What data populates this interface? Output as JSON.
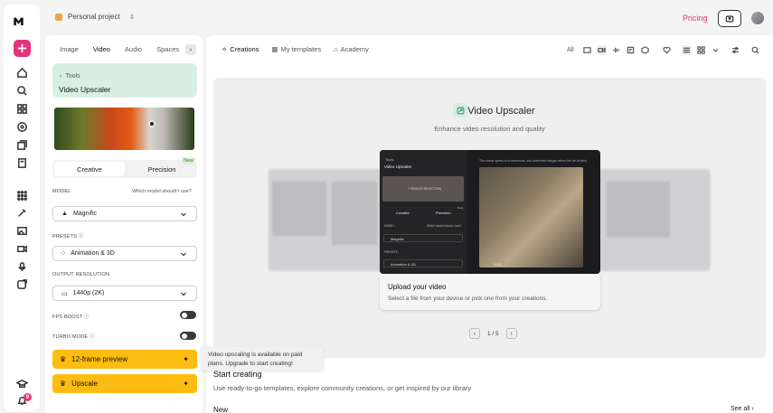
{
  "app": {
    "project": "Personal project",
    "pricing": "Pricing"
  },
  "left_tabs": [
    "Image",
    "Video",
    "Audio",
    "Spaces"
  ],
  "left_active_tab": "Video",
  "tool": {
    "breadcrumb": "Tools",
    "title": "Video Upscaler"
  },
  "modes": {
    "creative": "Creative",
    "precision": "Precision",
    "new_badge": "New"
  },
  "model": {
    "label": "MODEL",
    "help": "Which model should I use?",
    "value": "Magnific"
  },
  "presets": {
    "label": "PRESETS",
    "value": "Animation & 3D"
  },
  "resolution": {
    "label": "OUTPUT RESOLUTION",
    "value": "1440p (2K)"
  },
  "fps_boost": {
    "label": "FPS BOOST",
    "on": false
  },
  "turbo": {
    "label": "TURBO MODE",
    "on": false
  },
  "buttons": {
    "preview": "12-frame preview",
    "upscale": "Upscale"
  },
  "tooltip": "Video upscaling is available on paid plans. Upgrade to start creating!",
  "main_tabs": [
    "Creations",
    "My templates",
    "Academy"
  ],
  "filter_all": "All",
  "hero": {
    "title": "Video Upscaler",
    "subtitle": "Enhance video resolution and quality"
  },
  "demo": {
    "breadcrumb": "Tools",
    "title": "Video Upscaler",
    "prompt": "The scene opens in a cavernous, sun-drenched hangar where the air is thick",
    "select_video": "+ VIDEOS SELECTION",
    "creative": "Creative",
    "precision": "Precision",
    "new_badge": "New",
    "model": "MODEL",
    "model_help": "Which model should I use?",
    "model_value": "Magnific",
    "presets": "PRESETS",
    "presets_value": "Animation & 3D",
    "timestamp": "0:03"
  },
  "upload": {
    "title": "Upload your video",
    "subtitle": "Select a file from your device or pick one from your creations."
  },
  "pager": {
    "current": 1,
    "total": 5,
    "text": "1 / 5"
  },
  "start": {
    "title": "Start creating",
    "subtitle": "Use ready-to-go templates, explore community creations, or get inspired by our library"
  },
  "new_section": {
    "title": "New",
    "see_all": "See all"
  },
  "notifications": {
    "count": "9"
  },
  "colors": {
    "accent": "#e8317d",
    "yellow": "#fdbc11",
    "tool_card": "#d9efe4"
  }
}
